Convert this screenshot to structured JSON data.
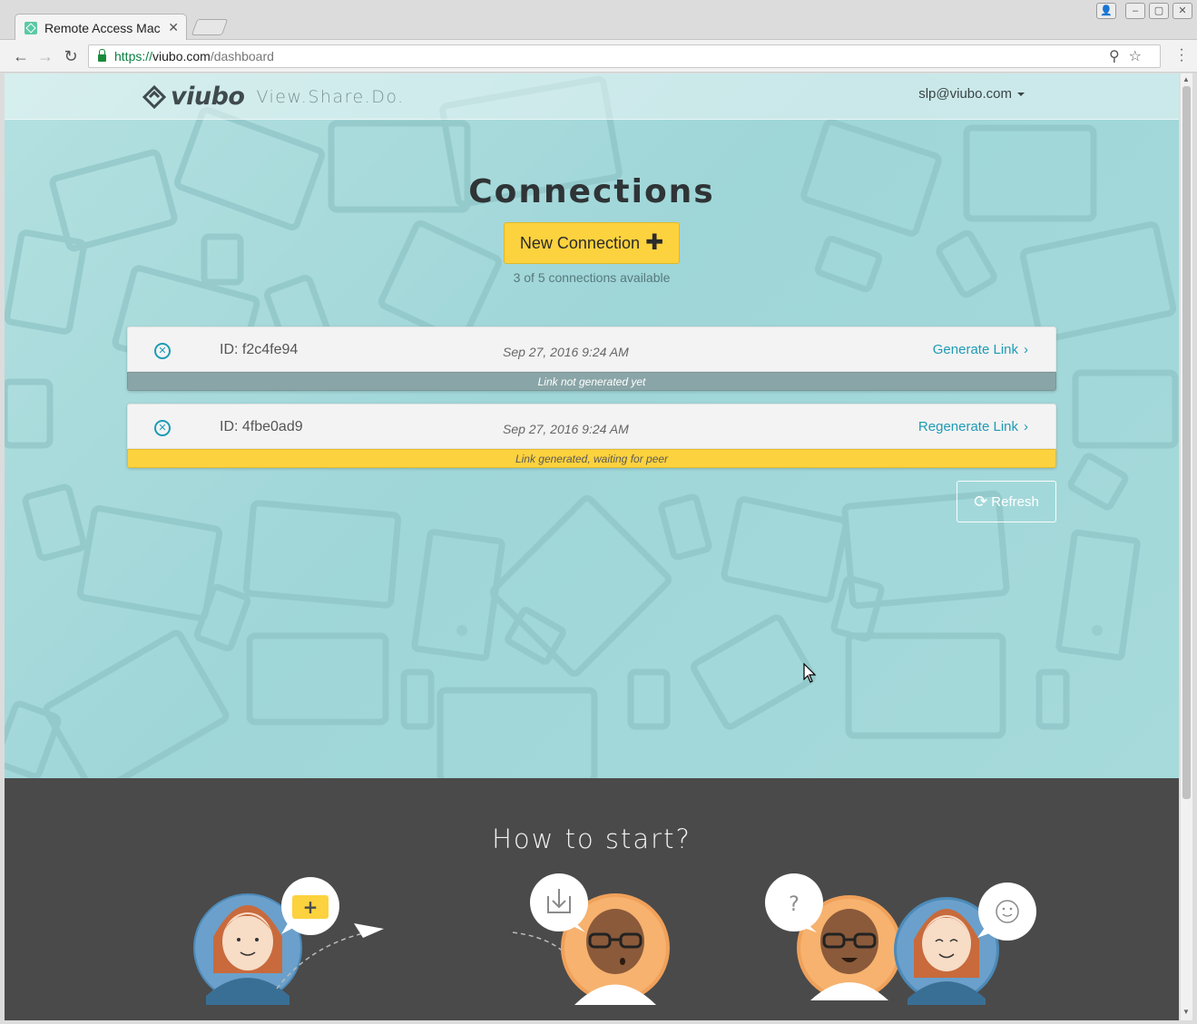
{
  "browser": {
    "tab_title": "Remote Access Mac",
    "url_scheme": "https://",
    "url_host": "viubo.com",
    "url_path": "/dashboard"
  },
  "header": {
    "logo_text": "viubo",
    "tagline": "View.Share.Do.",
    "user_email": "slp@viubo.com"
  },
  "main": {
    "title": "Connections",
    "new_connection_label": "New Connection",
    "availability": "3 of 5 connections available",
    "refresh_label": "Refresh"
  },
  "connections": [
    {
      "id": "ID: f2c4fe94",
      "date": "Sep 27, 2016 9:24 AM",
      "link_label": "Generate Link",
      "status": "Link not generated yet",
      "status_color": "#8aa5a7"
    },
    {
      "id": "ID: 4fbe0ad9",
      "date": "Sep 27, 2016 9:24 AM",
      "link_label": "Regenerate Link",
      "status": "Link generated, waiting for peer",
      "status_color": "#fcd23e"
    }
  ],
  "howto": {
    "title": "How to start?"
  },
  "colors": {
    "accent": "#1e9bb5",
    "cta": "#fcd23e",
    "hero_bg": "#a5d9da",
    "footer_bg": "#4a4a4a"
  },
  "icons": {
    "remove": "close-circle-icon",
    "chevron": "chevron-right-icon",
    "refresh": "refresh-icon",
    "plus": "plus-icon"
  }
}
